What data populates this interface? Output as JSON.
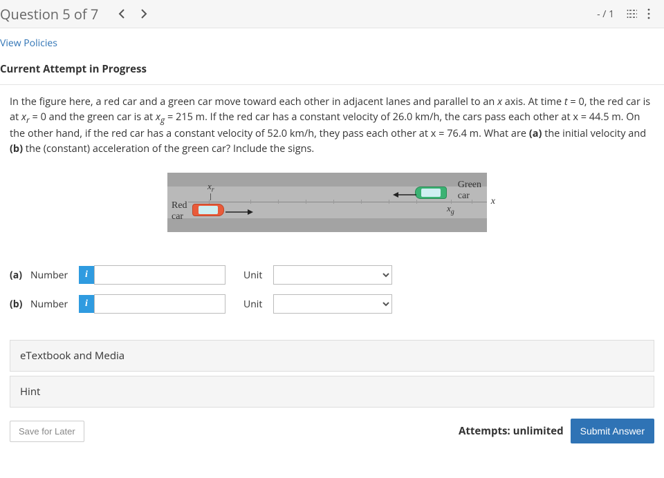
{
  "header": {
    "title": "Question 5 of 7",
    "score": "- / 1"
  },
  "policies_link": "View Policies",
  "section_title": "Current Attempt in Progress",
  "problem_html": "In the figure here, a red car and a green car move toward each other in adjacent lanes and parallel to an x axis. At time t = 0, the red car is at x_r = 0 and the green car is at x_g = 215 m. If the red car has a constant velocity of 26.0 km/h, the cars pass each other at x = 44.5 m. On the other hand, if the red car has a constant velocity of 52.0 km/h, they pass each other at x = 76.4 m. What are (a) the initial velocity and (b) the (constant) acceleration of the green car? Include the signs.",
  "figure": {
    "red_label": "Red\ncar",
    "green_label": "Green\ncar",
    "xr": "x_r",
    "xg": "x_g",
    "x": "x"
  },
  "parts": {
    "a": {
      "tag": "(a)",
      "number_label": "Number",
      "unit_label": "Unit"
    },
    "b": {
      "tag": "(b)",
      "number_label": "Number",
      "unit_label": "Unit"
    }
  },
  "accordion": {
    "etext": "eTextbook and Media",
    "hint": "Hint"
  },
  "footer": {
    "save": "Save for Later",
    "attempts": "Attempts: unlimited",
    "submit": "Submit Answer"
  }
}
